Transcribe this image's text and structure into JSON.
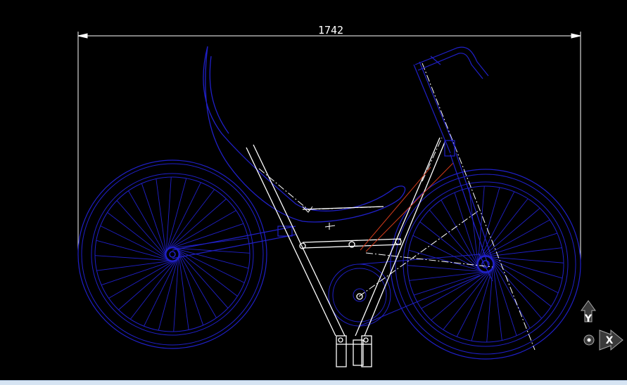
{
  "drawing": {
    "dimension_label": "1742",
    "ucs": {
      "y_label": "Y",
      "x_label": "X"
    },
    "colors": {
      "background": "#000000",
      "wheel": "#2020c8",
      "frame": "#ffffff",
      "accent_line": "#d03a1a",
      "dimension": "#ffffff"
    }
  }
}
